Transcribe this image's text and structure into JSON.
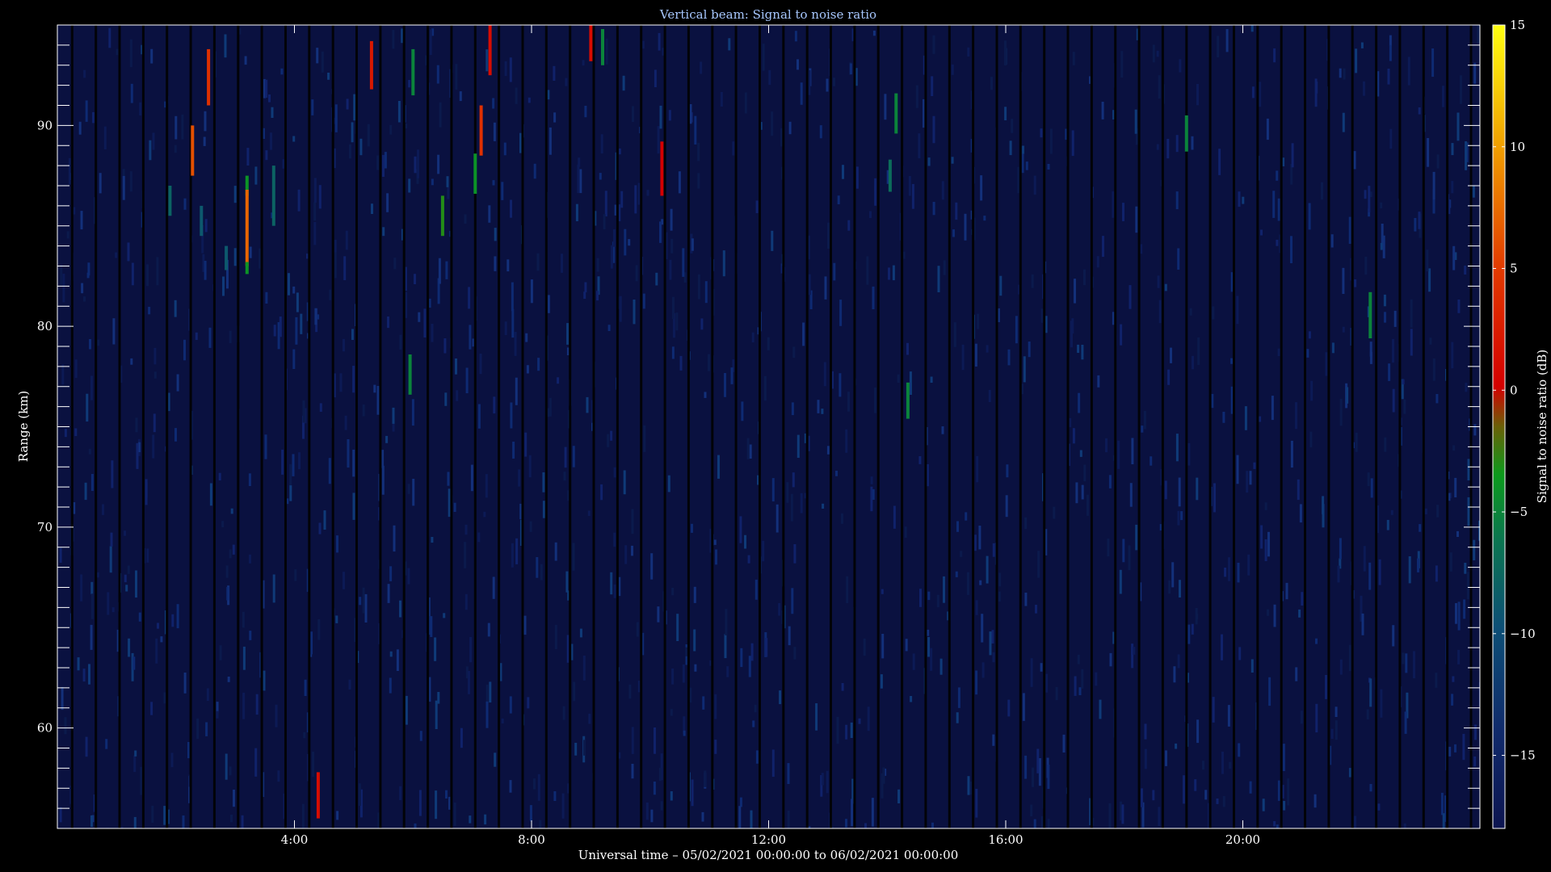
{
  "chart_data": {
    "type": "heatmap",
    "title": "Vertical beam: Signal to noise ratio",
    "xlabel": "Universal time – 05/02/2021 00:00:00 to 06/02/2021 00:00:00",
    "ylabel": "Range (km)",
    "colorbar_label": "Signal to noise ratio (dB)",
    "xlim_hours": [
      0,
      24
    ],
    "ylim_km": [
      55,
      95
    ],
    "clim_db": [
      -18,
      15
    ],
    "x_major_ticks": [
      4,
      8,
      12,
      16,
      20
    ],
    "x_tick_labels": [
      "4:00",
      "8:00",
      "12:00",
      "16:00",
      "20:00"
    ],
    "y_major_ticks": [
      60,
      70,
      80,
      90
    ],
    "y_tick_labels": [
      "60",
      "70",
      "80",
      "90"
    ],
    "y_minor_step": 1,
    "colorbar_ticks": [
      15,
      10,
      5,
      0,
      -5,
      -10,
      -15
    ],
    "colorbar_tick_labels": [
      "15",
      "10",
      "5",
      "0",
      "−5",
      "−10",
      "−15"
    ],
    "background_snr_db": -16,
    "grid": false,
    "colorbar_position": "right",
    "events": [
      {
        "t": 1.9,
        "r0": 85.5,
        "r1": 87.0,
        "snr": -8
      },
      {
        "t": 2.28,
        "r0": 87.5,
        "r1": 90.0,
        "snr": 6
      },
      {
        "t": 2.43,
        "r0": 84.5,
        "r1": 86.0,
        "snr": -9
      },
      {
        "t": 2.55,
        "r0": 91.0,
        "r1": 93.8,
        "snr": 4
      },
      {
        "t": 2.85,
        "r0": 82.8,
        "r1": 84.0,
        "snr": -9
      },
      {
        "t": 3.2,
        "r0": 86.5,
        "r1": 87.5,
        "snr": -4
      },
      {
        "t": 3.2,
        "r0": 83.0,
        "r1": 86.8,
        "snr": 7
      },
      {
        "t": 3.2,
        "r0": 82.6,
        "r1": 83.2,
        "snr": -4
      },
      {
        "t": 3.65,
        "r0": 85.0,
        "r1": 88.0,
        "snr": -8
      },
      {
        "t": 4.4,
        "r0": 55.5,
        "r1": 57.8,
        "snr": 1
      },
      {
        "t": 5.3,
        "r0": 91.8,
        "r1": 94.2,
        "snr": 2
      },
      {
        "t": 5.95,
        "r0": 76.6,
        "r1": 78.6,
        "snr": -5
      },
      {
        "t": 6.0,
        "r0": 91.5,
        "r1": 93.8,
        "snr": -5
      },
      {
        "t": 6.5,
        "r0": 84.5,
        "r1": 86.5,
        "snr": -3
      },
      {
        "t": 7.05,
        "r0": 86.6,
        "r1": 88.6,
        "snr": -4
      },
      {
        "t": 7.15,
        "r0": 88.5,
        "r1": 91.0,
        "snr": 4
      },
      {
        "t": 7.3,
        "r0": 92.5,
        "r1": 95.0,
        "snr": 1
      },
      {
        "t": 9.0,
        "r0": 93.2,
        "r1": 95.0,
        "snr": 1
      },
      {
        "t": 9.2,
        "r0": 93.0,
        "r1": 94.8,
        "snr": -5
      },
      {
        "t": 10.2,
        "r0": 86.5,
        "r1": 89.2,
        "snr": 0
      },
      {
        "t": 14.05,
        "r0": 86.7,
        "r1": 88.3,
        "snr": -7
      },
      {
        "t": 14.15,
        "r0": 89.6,
        "r1": 91.6,
        "snr": -5
      },
      {
        "t": 14.35,
        "r0": 75.4,
        "r1": 77.2,
        "snr": -5
      },
      {
        "t": 19.05,
        "r0": 88.7,
        "r1": 90.5,
        "snr": -5
      },
      {
        "t": 22.15,
        "r0": 79.4,
        "r1": 81.7,
        "snr": -5
      }
    ]
  }
}
